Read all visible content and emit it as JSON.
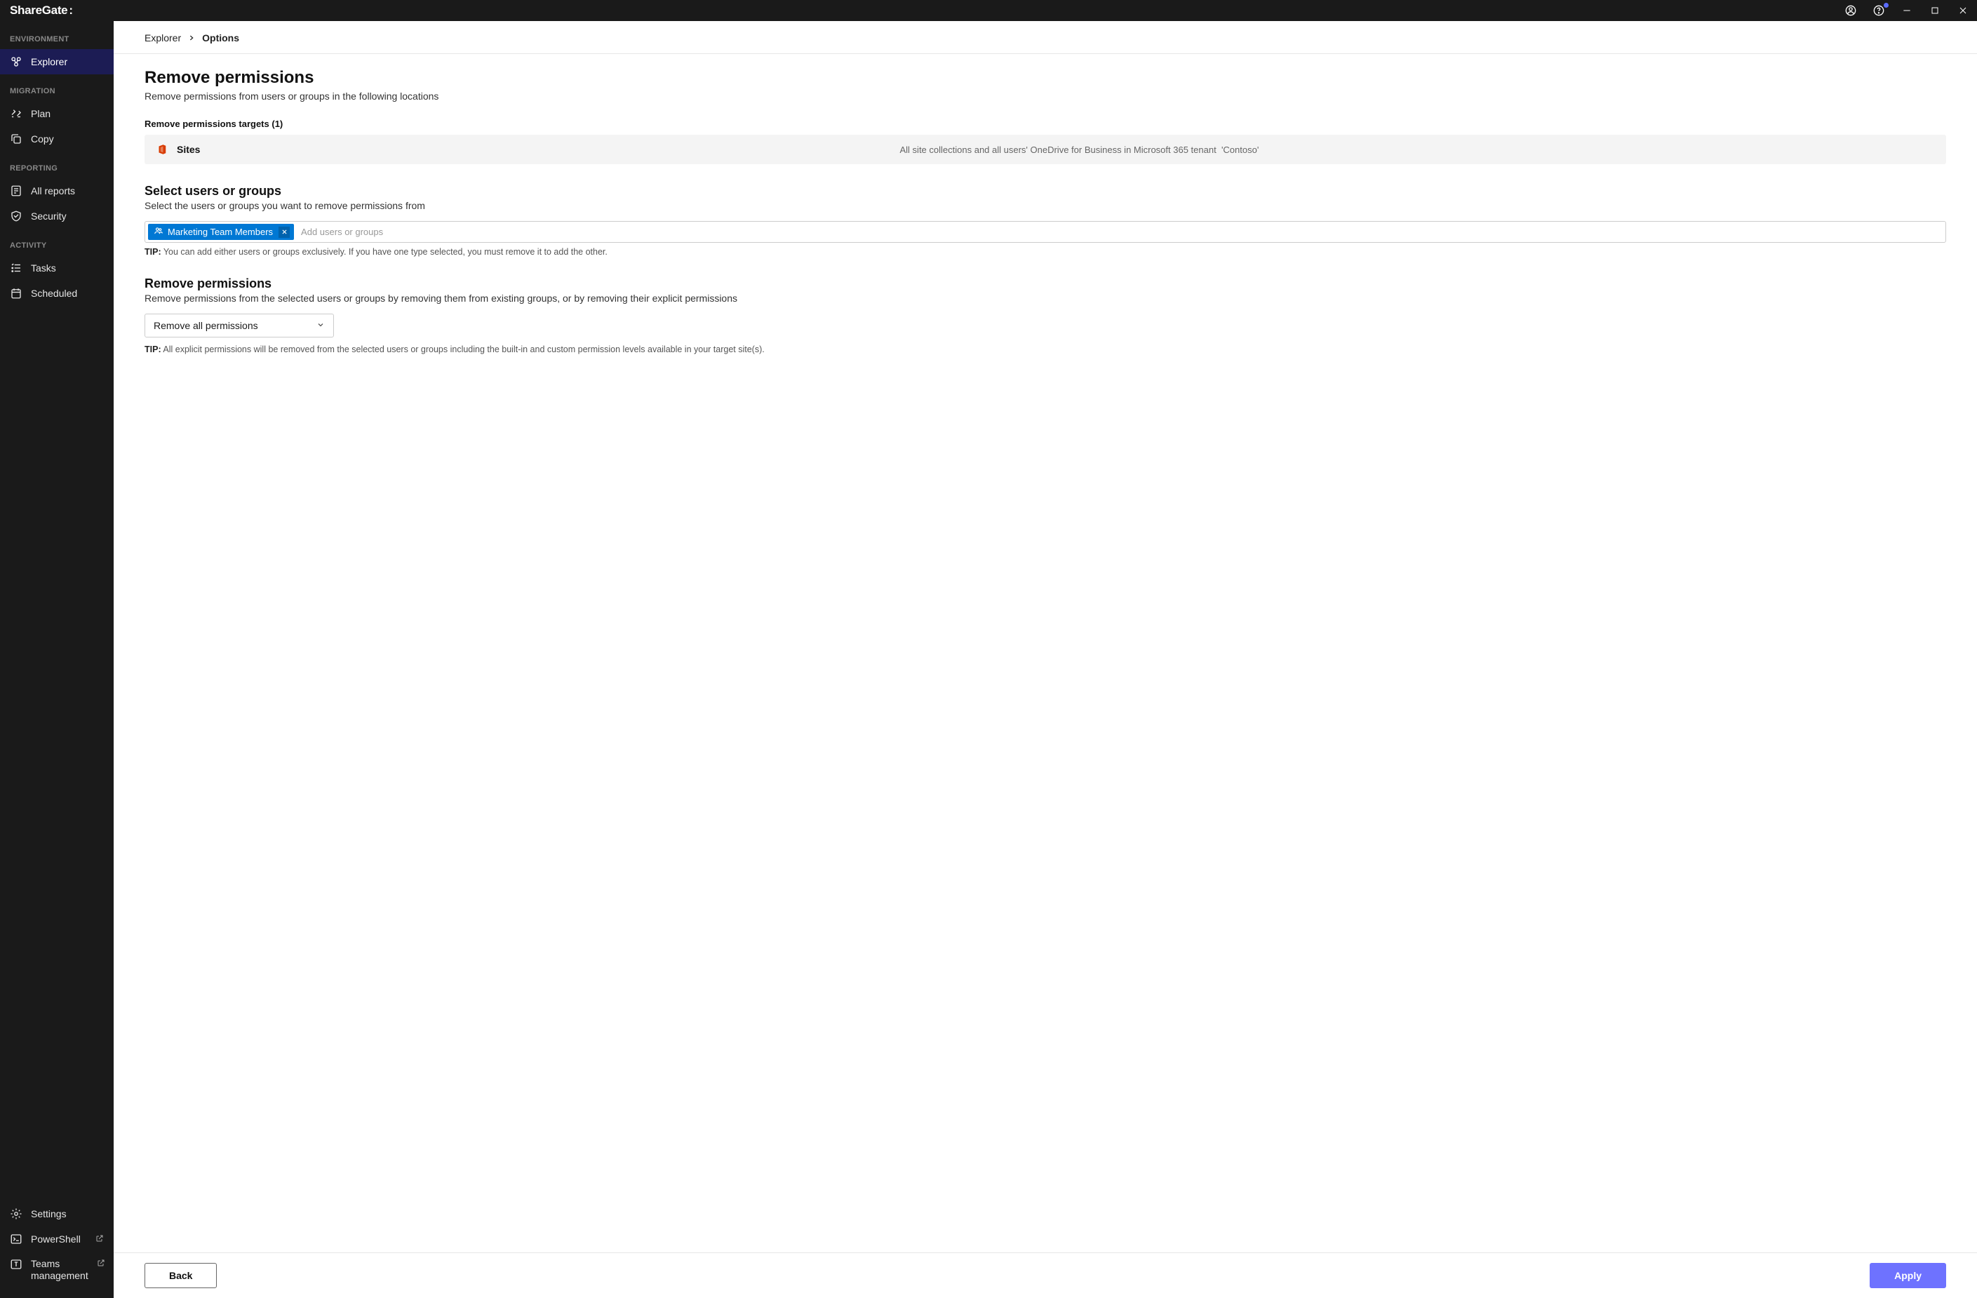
{
  "app_name": "ShareGate",
  "titlebar": {
    "account_icon": "account-circle-icon",
    "help_icon": "help-icon",
    "minimize_icon": "minimize-icon",
    "maximize_icon": "maximize-icon",
    "close_icon": "close-icon"
  },
  "sidebar": {
    "sections": [
      {
        "title": "ENVIRONMENT",
        "items": [
          {
            "id": "explorer",
            "label": "Explorer",
            "active": true
          }
        ]
      },
      {
        "title": "MIGRATION",
        "items": [
          {
            "id": "plan",
            "label": "Plan"
          },
          {
            "id": "copy",
            "label": "Copy"
          }
        ]
      },
      {
        "title": "REPORTING",
        "items": [
          {
            "id": "all-reports",
            "label": "All reports"
          },
          {
            "id": "security",
            "label": "Security"
          }
        ]
      },
      {
        "title": "ACTIVITY",
        "items": [
          {
            "id": "tasks",
            "label": "Tasks"
          },
          {
            "id": "scheduled",
            "label": "Scheduled"
          }
        ]
      }
    ],
    "bottom": [
      {
        "id": "settings",
        "label": "Settings"
      },
      {
        "id": "powershell",
        "label": "PowerShell",
        "external": true
      },
      {
        "id": "teams-management",
        "label": "Teams\nmanagement",
        "external": true
      }
    ]
  },
  "breadcrumb": {
    "parent": "Explorer",
    "current": "Options"
  },
  "page": {
    "title": "Remove permissions",
    "subtitle": "Remove permissions from users or groups in the following locations"
  },
  "targets": {
    "label_prefix": "Remove permissions targets",
    "count": 1,
    "items": [
      {
        "name": "Sites",
        "desc_prefix": "All site collections and all users' OneDrive for Business in Microsoft 365 tenant",
        "tenant": "'Contoso'"
      }
    ]
  },
  "select_users": {
    "title": "Select users or groups",
    "desc": "Select the users or groups you want to remove permissions from",
    "chips": [
      {
        "label": "Marketing Team Members"
      }
    ],
    "placeholder": "Add users or groups",
    "tip_label": "TIP:",
    "tip_text": "You can add either users or groups exclusively. If you have one type selected, you must remove it to add the other."
  },
  "remove_perms": {
    "title": "Remove permissions",
    "desc": "Remove permissions from the selected users or groups by removing them from existing groups, or by removing their explicit permissions",
    "select_value": "Remove all permissions",
    "tip_label": "TIP:",
    "tip_text": "All explicit permissions will be removed from the selected users or groups including the built-in and custom permission levels available in your target site(s)."
  },
  "footer": {
    "back": "Back",
    "apply": "Apply"
  }
}
